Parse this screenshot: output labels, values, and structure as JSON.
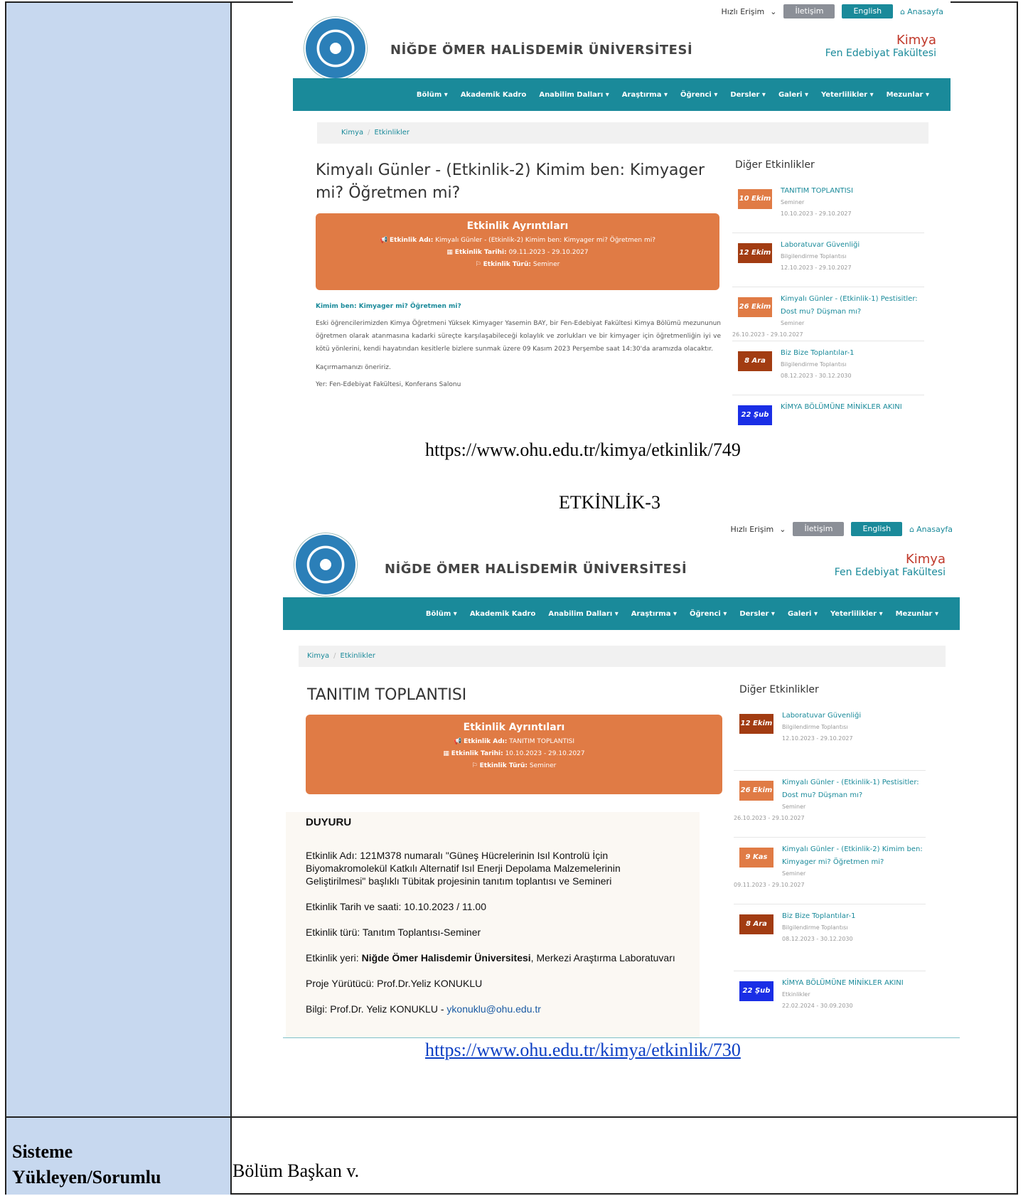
{
  "doc": {
    "row_label_1": "Sisteme",
    "row_label_2": "Yükleyen/Sorumlu",
    "row_value": "Bölüm Başkan v.",
    "caption_url_1": "https://www.ohu.edu.tr/kimya/etkinlik/749",
    "heading_3": "ETKİNLİK-3",
    "caption_url_2": "https://www.ohu.edu.tr/kimya/etkinlik/730"
  },
  "site": {
    "quick_access": "Hızlı Erişim",
    "contact": "İletişim",
    "english": "English",
    "home": "Anasayfa",
    "university": "NİĞDE ÖMER HALİSDEMİR ÜNİVERSİTESİ",
    "dept": "Kimya",
    "faculty": "Fen Edebiyat Fakültesi",
    "nav": [
      "Bölüm ▾",
      "Akademik Kadro",
      "Anabilim Dalları ▾",
      "Araştırma ▾",
      "Öğrenci ▾",
      "Dersler ▾",
      "Galeri ▾",
      "Yeterlilikler ▾",
      "Mezunlar ▾"
    ],
    "crumb_home": "Kimya",
    "crumb_page": "Etkinlikler",
    "side_heading": "Diğer Etkinlikler",
    "details_heading": "Etkinlik Ayrıntıları",
    "lbl_name": "Etkinlik Adı:",
    "lbl_date": "Etkinlik Tarihi:",
    "lbl_type": "Etkinlik Türü:"
  },
  "page1": {
    "title": "Kimyalı Günler - (Etkinlik-2) Kimim ben: Kimyager mi? Öğretmen mi?",
    "ev_name": "Kimyalı Günler - (Etkinlik-2) Kimim ben: Kimyager mi? Öğretmen mi?",
    "ev_date": "09.11.2023 - 29.10.2027",
    "ev_type": "Seminer",
    "subheading": "Kimim ben: Kimyager mi? Öğretmen mi?",
    "para": "Eski öğrencilerimizden Kimya Öğretmeni Yüksek Kimyager Yasemin BAY, bir Fen-Edebiyat Fakültesi Kimya Bölümü mezununun öğretmen olarak atanmasına kadarki süreçte karşılaşabileceği kolaylık ve zorlukları ve bir kimyager için öğretmenliğin iyi ve kötü yönlerini, kendi hayatından kesitlerle bizlere sunmak üzere 09 Kasım 2023 Perşembe saat 14:30'da aramızda olacaktır.",
    "miss": "Kaçırmamanızı öneririz.",
    "place": "Yer: Fen-Edebiyat Fakültesi, Konferans Salonu",
    "events": [
      {
        "date": "10 Ekim",
        "title": "TANITIM TOPLANTISI",
        "type": "Seminer",
        "range": "10.10.2023 - 29.10.2027",
        "color": "#e07b45"
      },
      {
        "date": "12 Ekim",
        "title": "Laboratuvar Güvenliği",
        "type": "Bilgilendirme Toplantısı",
        "range": "12.10.2023 - 29.10.2027",
        "color": "#a23c12"
      },
      {
        "date": "26 Ekim",
        "title": "Kimyalı Günler - (Etkinlik-1) Pestisitler: Dost mu? Düşman mı?",
        "type": "Seminer",
        "range": "26.10.2023 - 29.10.2027",
        "color": "#e07b45"
      },
      {
        "date": "8 Ara",
        "title": "Biz Bize Toplantılar-1",
        "type": "Bilgilendirme Toplantısı",
        "range": "08.12.2023 - 30.12.2030",
        "color": "#a23c12"
      },
      {
        "date": "22 Şub",
        "title": "KİMYA BÖLÜMÜNE MİNİKLER AKINI",
        "type": "",
        "range": "",
        "color": "#1a2ee6"
      }
    ]
  },
  "page2": {
    "title": "TANITIM TOPLANTISI",
    "ev_name": "TANITIM TOPLANTISI",
    "ev_date": "10.10.2023 - 29.10.2027",
    "ev_type": "Seminer",
    "duyuru": "DUYURU",
    "line_name": "Etkinlik Adı: 121M378 numaralı \"Güneş Hücrelerinin Isıl Kontrolü İçin Biyomakromolekül Katkılı Alternatif Isıl Enerji Depolama Malzemelerinin Geliştirilmesi\" başlıklı Tübitak projesinin tanıtım toplantısı ve Semineri",
    "line_date": "Etkinlik Tarih ve saati: 10.10.2023 / 11.00",
    "line_type": "Etkinlik türü: Tanıtım Toplantısı-Seminer",
    "line_place_a": "Etkinlik yeri: ",
    "line_place_b": "Niğde Ömer Halisdemir Üniversitesi",
    "line_place_c": ", Merkezi Araştırma Laboratuvarı",
    "line_exec": "Proje Yürütücü: Prof.Dr.Yeliz KONUKLU",
    "line_info_a": "Bilgi: Prof.Dr. Yeliz KONUKLU - ",
    "line_info_b": "ykonuklu@ohu.edu.tr",
    "events": [
      {
        "date": "12 Ekim",
        "title": "Laboratuvar Güvenliği",
        "type": "Bilgilendirme Toplantısı",
        "range": "12.10.2023 - 29.10.2027",
        "color": "#a23c12"
      },
      {
        "date": "26 Ekim",
        "title": "Kimyalı Günler - (Etkinlik-1) Pestisitler: Dost mu? Düşman mı?",
        "type": "Seminer",
        "range": "26.10.2023 - 29.10.2027",
        "color": "#e07b45"
      },
      {
        "date": "9 Kas",
        "title": "Kimyalı Günler - (Etkinlik-2) Kimim ben: Kimyager mi? Öğretmen mi?",
        "type": "Seminer",
        "range": "09.11.2023 - 29.10.2027",
        "color": "#e07b45"
      },
      {
        "date": "8 Ara",
        "title": "Biz Bize Toplantılar-1",
        "type": "Bilgilendirme Toplantısı",
        "range": "08.12.2023 - 30.12.2030",
        "color": "#a23c12"
      },
      {
        "date": "22 Şub",
        "title": "KİMYA BÖLÜMÜNE MİNİKLER AKINI",
        "type": "Etkinlikler",
        "range": "22.02.2024 - 30.09.2030",
        "color": "#1a2ee6"
      }
    ]
  }
}
